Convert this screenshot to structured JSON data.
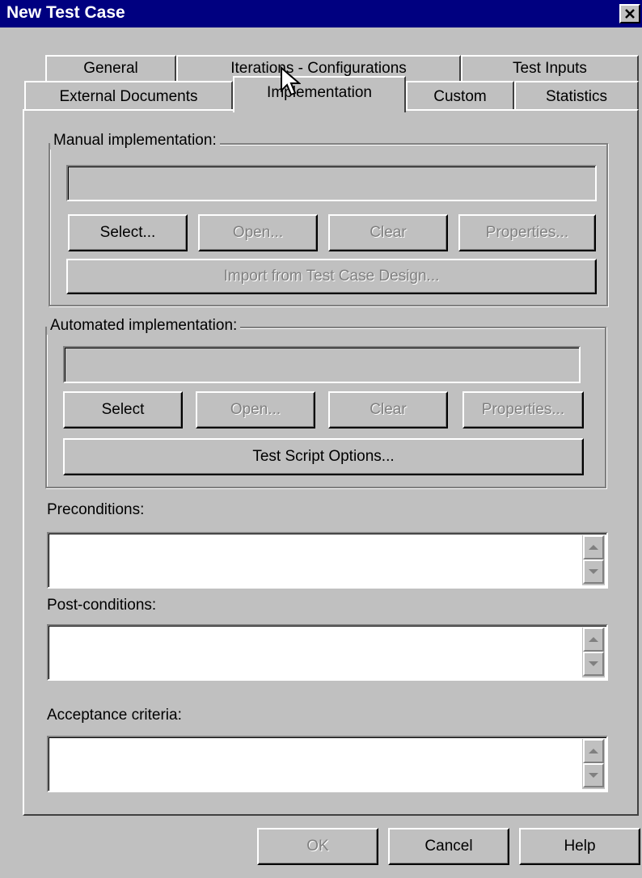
{
  "window": {
    "title": "New Test Case"
  },
  "tabs": {
    "row1": [
      "General",
      "Iterations - Configurations",
      "Test Inputs"
    ],
    "row2": [
      "External Documents",
      "Implementation",
      "Custom",
      "Statistics"
    ],
    "active": "Implementation"
  },
  "manual": {
    "label": "Manual implementation:",
    "path_value": "",
    "select": "Select...",
    "open": "Open...",
    "clear": "Clear",
    "properties": "Properties...",
    "import": "Import from Test Case Design..."
  },
  "automated": {
    "label": "Automated implementation:",
    "path_value": "",
    "select": "Select",
    "open": "Open...",
    "clear": "Clear",
    "properties": "Properties...",
    "script_options": "Test Script Options..."
  },
  "preconditions": {
    "label": "Preconditions:",
    "value": ""
  },
  "postconditions": {
    "label": "Post-conditions:",
    "value": ""
  },
  "acceptance": {
    "label": "Acceptance criteria:",
    "value": ""
  },
  "footer": {
    "ok": "OK",
    "cancel": "Cancel",
    "help": "Help"
  },
  "colors": {
    "titlebar": "#000080",
    "face": "#c0c0c0",
    "disabled_text": "#808080"
  },
  "icons": [
    "close-icon",
    "mouse-cursor-icon",
    "scroll-up-arrow-icon",
    "scroll-down-arrow-icon"
  ]
}
